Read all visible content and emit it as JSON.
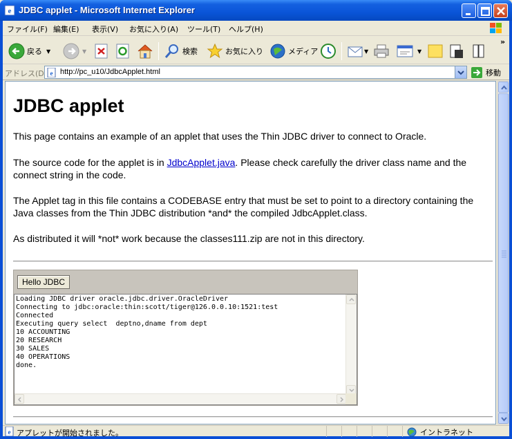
{
  "window": {
    "title": "JDBC applet - Microsoft Internet Explorer"
  },
  "menu": [
    "ファイル(F)",
    "編集(E)",
    "表示(V)",
    "お気に入り(A)",
    "ツール(T)",
    "ヘルプ(H)"
  ],
  "toolbar": {
    "back_label": "戻る",
    "search_label": "検索",
    "favorites_label": "お気に入り",
    "media_label": "メディア"
  },
  "address": {
    "label": "アドレス(D)",
    "url": "http://pc_u10/JdbcApplet.html",
    "go_label": "移動"
  },
  "page": {
    "heading": "JDBC applet",
    "p1": "This page contains an example of an applet that uses the Thin JDBC driver to connect to Oracle.",
    "p2_before": "The source code for the applet is in ",
    "p2_link": "JdbcApplet.java",
    "p2_after": ". Please check carefully the driver class name and the connect string in the code.",
    "p3": "The Applet tag in this file contains a CODEBASE entry that must be set to point to a directory containing the Java classes from the Thin JDBC distribution *and* the compiled JdbcApplet.class.",
    "p4": "As distributed it will *not* work because the classes111.zip are not in this directory."
  },
  "applet": {
    "button_label": "Hello JDBC",
    "output": [
      "Loading JDBC driver oracle.jdbc.driver.OracleDriver",
      "Connecting to jdbc:oracle:thin:scott/tiger@126.0.0.10:1521:test",
      "Connected",
      "Executing query select  deptno,dname from dept",
      "10 ACCOUNTING",
      "20 RESEARCH",
      "30 SALES",
      "40 OPERATIONS",
      "done."
    ]
  },
  "status": {
    "text": "アプレットが開始されました。",
    "zone": "イントラネット"
  }
}
